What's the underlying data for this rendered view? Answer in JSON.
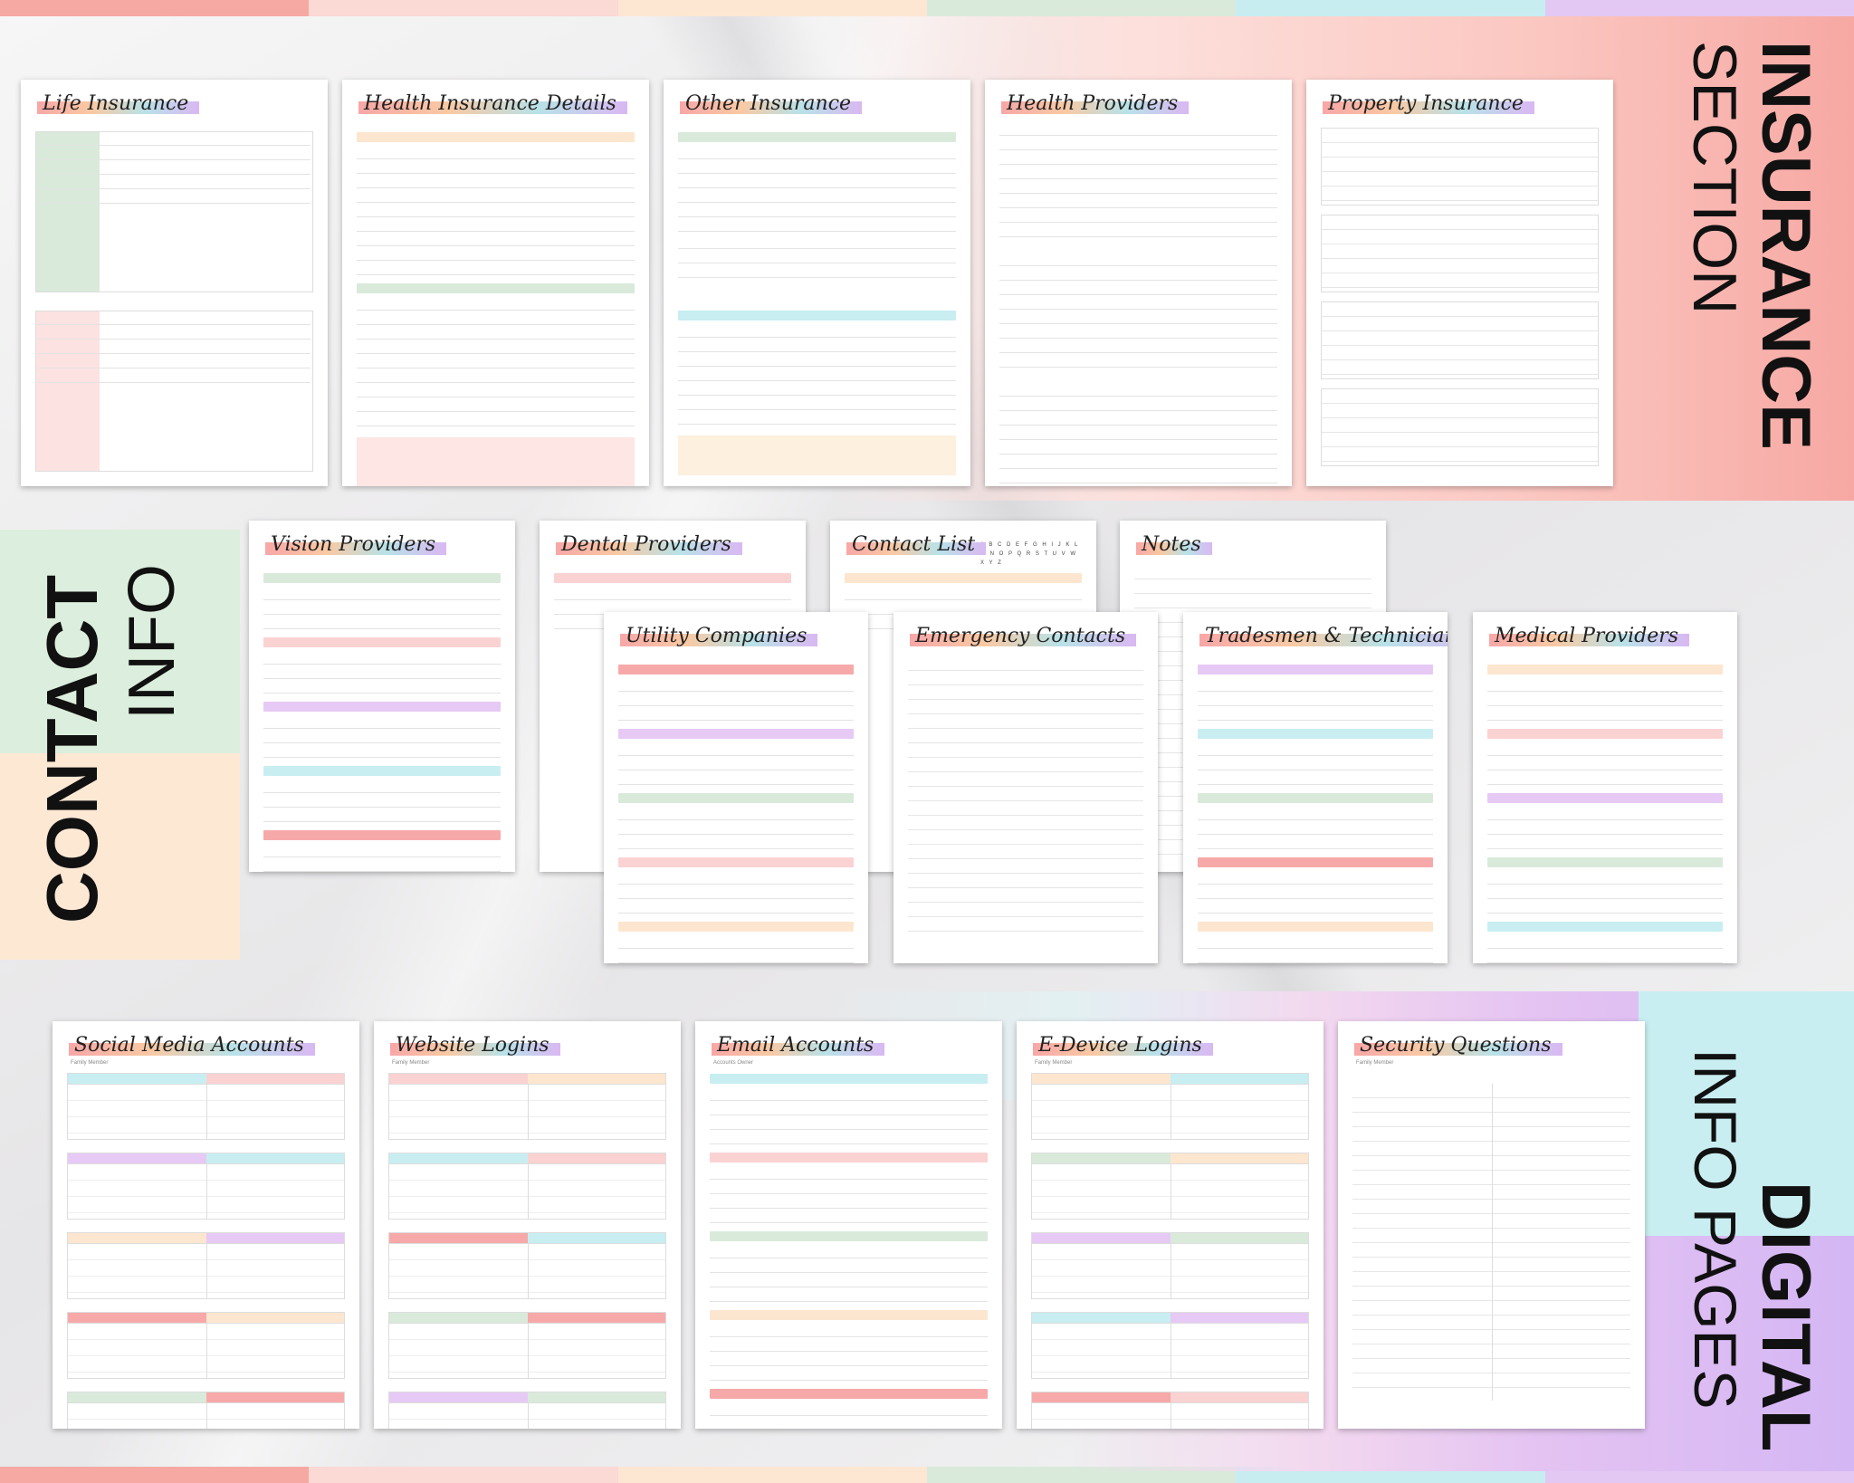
{
  "colors": {
    "pink": "#fbd2d2",
    "peach": "#fde6cf",
    "green": "#d9eadb",
    "blue": "#c8eef2",
    "purple": "#e7c9f5",
    "red": "#f7a9a9",
    "insurance_band": "#f7a8a3",
    "digital_band": "#d4b6f4"
  },
  "stripe_colors": [
    "#f6a9a3",
    "#fbd9d4",
    "#fde7d2",
    "#d9eadb",
    "#c7edf1",
    "#e3c8f4"
  ],
  "sections": {
    "insurance": {
      "line1": "INSURANCE",
      "line2": "SECTION"
    },
    "contact": {
      "line1": "CONTACT",
      "line2": "INFO"
    },
    "digital": {
      "line1": "DIGITAL",
      "line2": "INFO PAGES"
    }
  },
  "pages": {
    "life_insurance": {
      "title": "Life Insurance"
    },
    "health_insurance": {
      "title": "Health Insurance Details"
    },
    "other_insurance": {
      "title": "Other Insurance"
    },
    "health_providers": {
      "title": "Health Providers"
    },
    "property_insurance": {
      "title": "Property Insurance"
    },
    "vision_providers": {
      "title": "Vision Providers"
    },
    "dental_providers": {
      "title": "Dental Providers"
    },
    "contact_list": {
      "title": "Contact List",
      "alphabet": "A B C D E F G H I J K L M N O P Q R S T U V W X Y Z"
    },
    "notes": {
      "title": "Notes"
    },
    "utility_companies": {
      "title": "Utility Companies"
    },
    "emergency_contacts": {
      "title": "Emergency Contacts"
    },
    "tradesmen": {
      "title": "Tradesmen & Technicians"
    },
    "medical_providers": {
      "title": "Medical Providers"
    },
    "social_media": {
      "title": "Social Media Accounts",
      "sub": "Family Member"
    },
    "website_logins": {
      "title": "Website Logins",
      "sub": "Family Member"
    },
    "email_accounts": {
      "title": "Email Accounts",
      "sub": "Accounts Owner"
    },
    "edevice_logins": {
      "title": "E-Device Logins",
      "sub": "Family Member"
    },
    "security_questions": {
      "title": "Security Questions",
      "sub": "Family Member"
    }
  }
}
